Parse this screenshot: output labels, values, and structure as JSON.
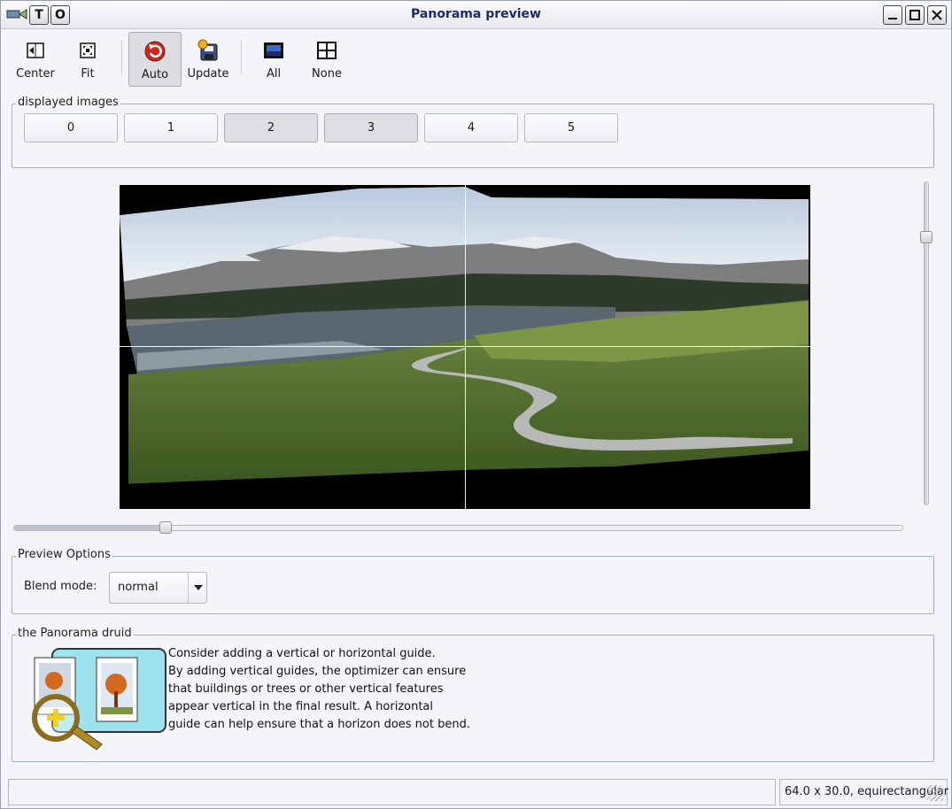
{
  "window": {
    "title": "Panorama preview"
  },
  "titlebar": {
    "left_buttons": [
      "T",
      "O"
    ],
    "right_buttons": [
      "minimize-icon",
      "maximize-icon",
      "close-icon"
    ]
  },
  "toolbar": {
    "center_label": "Center",
    "fit_label": "Fit",
    "auto_label": "Auto",
    "update_label": "Update",
    "all_label": "All",
    "none_label": "None"
  },
  "displayed_images": {
    "title": "displayed images",
    "buttons": [
      {
        "label": "0",
        "pressed": false
      },
      {
        "label": "1",
        "pressed": false
      },
      {
        "label": "2",
        "pressed": true
      },
      {
        "label": "3",
        "pressed": true
      },
      {
        "label": "4",
        "pressed": false
      },
      {
        "label": "5",
        "pressed": false
      }
    ]
  },
  "preview": {
    "guides": {
      "vertical": true,
      "horizontal": true
    }
  },
  "sliders": {
    "horizontal_level": 0.17,
    "vertical_level": 0.15
  },
  "preview_options": {
    "title": "Preview Options",
    "blend_label": "Blend mode:",
    "blend_value": "normal"
  },
  "druid": {
    "title": "the Panorama druid",
    "lines": [
      "Consider adding a vertical or horizontal guide.",
      "By adding vertical guides, the optimizer can ensure",
      "that buildings or trees or other vertical features",
      "appear vertical in the final result.  A horizontal",
      "guide can help ensure that a horizon does not bend."
    ]
  },
  "status": {
    "left": "",
    "right": "64.0 x 30.0, equirectangular"
  },
  "colors": {
    "title_text": "#1d2a6b",
    "group_border": "#9fb0cc",
    "window_bg": "#f4f5f9"
  }
}
